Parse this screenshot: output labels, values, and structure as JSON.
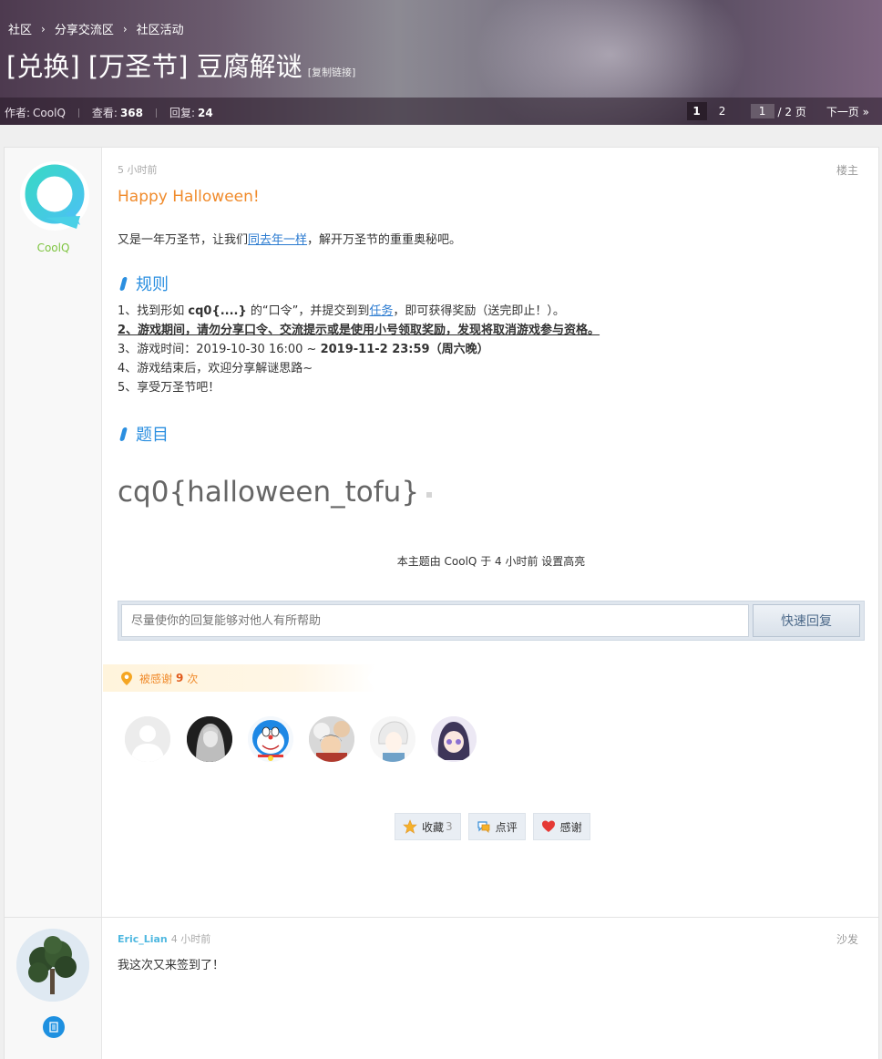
{
  "breadcrumb": [
    "社区",
    "分享交流区",
    "社区活动"
  ],
  "thread": {
    "title": "[兑换] [万圣节] 豆腐解谜",
    "copy_link": "[复制链接]",
    "author_label": "作者:",
    "author": "CoolQ",
    "views_label": "查看:",
    "views": "368",
    "replies_label": "回复:",
    "replies": "24"
  },
  "pager": {
    "pages": [
      "1",
      "2"
    ],
    "current": "1",
    "input_value": "1",
    "total": "/ 2 页",
    "next": "下一页 »"
  },
  "post1": {
    "author": "CoolQ",
    "time": "5 小时前",
    "floor": "楼主",
    "greeting": "Happy Halloween!",
    "intro_before": "又是一年万圣节，让我们",
    "intro_link": "同去年一样",
    "intro_after": "，解开万圣节的重重奥秘吧。",
    "section_rules": "规则",
    "rule1_a": "1、找到形如 ",
    "rule1_b": "cq0{....}",
    "rule1_c": " 的“口令”，并提交到到",
    "rule1_link": "任务",
    "rule1_d": "，即可获得奖励（送完即止！）。",
    "rule2": "2、游戏期间，请勿分享口令、交流提示或是使用小号领取奖励，发现将取消游戏参与资格。",
    "rule3_a": "3、游戏时间：2019-10-30 16:00 ~ ",
    "rule3_b": "2019-11-2 23:59（周六晚）",
    "rule4": "4、游戏结束后，欢迎分享解谜思路~",
    "rule5": "5、享受万圣节吧！",
    "section_question": "题目",
    "flag": "cq0{halloween_tofu}",
    "highlight_note": "本主题由 CoolQ 于 4 小时前 设置高亮",
    "reply_placeholder": "尽量使你的回复能够对他人有所帮助",
    "reply_button": "快速回复",
    "thanks_label": "被感谢",
    "thanks_count": "9",
    "thanks_unit": "次",
    "actions": {
      "favorite": "收藏",
      "favorite_count": "3",
      "comment": "点评",
      "thank": "感谢"
    }
  },
  "post2": {
    "author": "Eric_Lian",
    "time": "4 小时前",
    "floor": "沙发",
    "content": "我这次又来签到了！"
  },
  "colors": {
    "accent_orange": "#f08b2c",
    "link_blue": "#2b7bd0",
    "section_blue": "#2b8fe0",
    "username_green": "#7ec440"
  }
}
